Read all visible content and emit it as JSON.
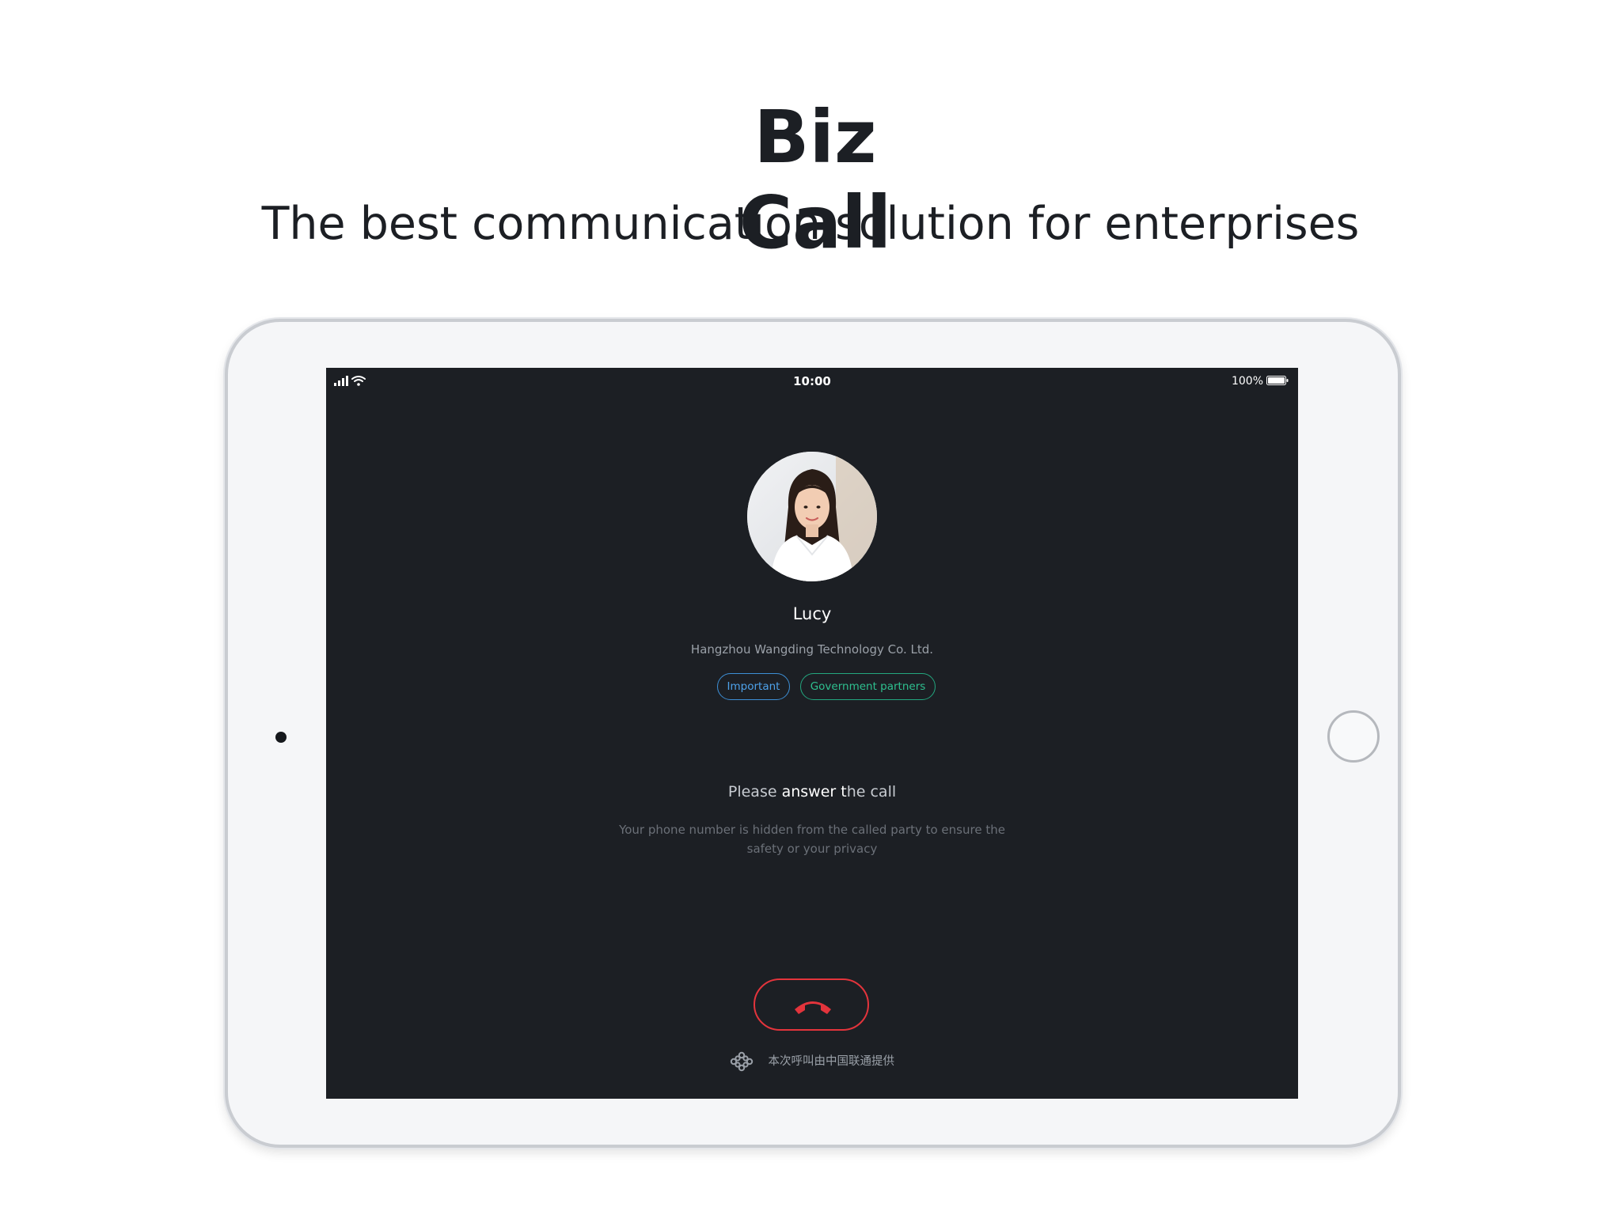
{
  "promo": {
    "title_line1": "Biz",
    "title_line2": "Call",
    "subtitle": "The best communication solution for enterprises"
  },
  "status_bar": {
    "time": "10:00",
    "battery_percent": "100%",
    "signal_icon": "signal-icon",
    "wifi_icon": "wifi-icon",
    "battery_icon": "battery-icon"
  },
  "caller": {
    "name": "Lucy",
    "company": "Hangzhou Wangding Technology Co. Ltd.",
    "tags": [
      {
        "label": "Important",
        "color": "#4ea2ea"
      },
      {
        "label": "Government partners",
        "color": "#2ec08f"
      }
    ]
  },
  "call": {
    "prompt_before": "Please ",
    "prompt_emphasis": "answer t",
    "prompt_after": "he call",
    "privacy_note": "Your phone number is hidden from the called party to ensure the safety or your privacy",
    "hangup_icon": "hang-up-icon",
    "hangup_color": "#e3343c"
  },
  "footer": {
    "carrier_icon": "china-unicom-logo-icon",
    "carrier_text": "本次呼叫由中国联通提供"
  },
  "colors": {
    "screen_background": "#1c1f24",
    "device_frame": "#f5f6f8",
    "accent_blue": "#4ea2ea",
    "accent_green": "#2ec08f",
    "danger_red": "#e3343c"
  }
}
